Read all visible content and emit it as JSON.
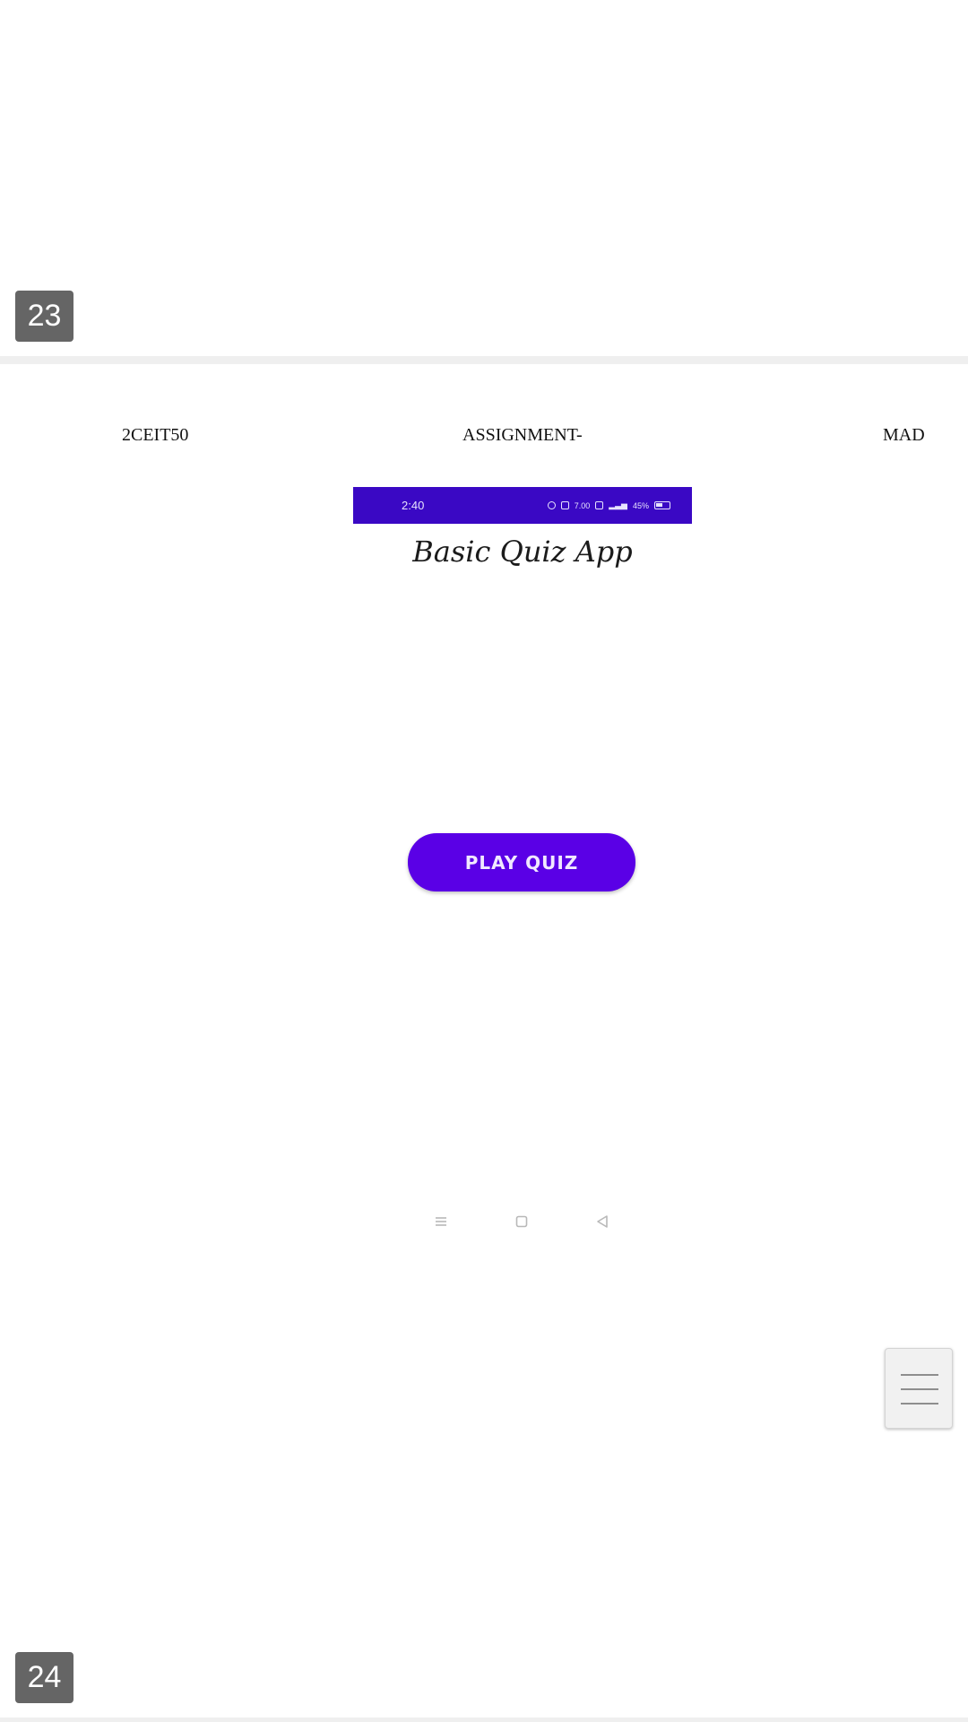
{
  "page_numbers": {
    "top": "23",
    "bottom": "24"
  },
  "document_header": {
    "left": "2CEIT50",
    "center": "ASSIGNMENT-",
    "right": "MAD"
  },
  "phone_screenshot": {
    "status_bar": {
      "time": "2:40",
      "data_speed": "7.00",
      "battery_percent": "45%"
    },
    "app_title": "Basic Quiz App",
    "play_button_label": "PLAY QUIZ",
    "nav_bar_icons": [
      "recents-icon",
      "home-icon",
      "back-icon"
    ]
  },
  "floating_button_icon": "hamburger-menu-icon",
  "colors": {
    "status_bar": "#3a08c4",
    "play_button": "#5a00e6",
    "page_badge": "#656565"
  }
}
